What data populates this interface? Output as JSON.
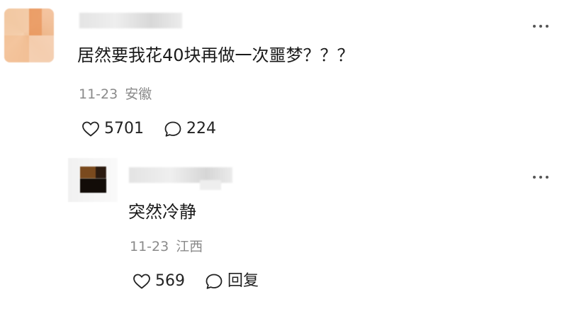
{
  "comment": {
    "text": "居然要我花40块再做一次噩梦？？？",
    "date": "11-23",
    "location": "安徽",
    "likes": "5701",
    "replies": "224"
  },
  "reply": {
    "text": "突然冷静",
    "date": "11-23",
    "location": "江西",
    "likes": "569",
    "reply_label": "回复"
  },
  "icons": {
    "more": "more-dots-icon",
    "like": "heart-icon",
    "comment": "comment-bubble-icon"
  },
  "colors": {
    "text": "#1a1a1a",
    "meta": "#8a8a8a",
    "icon": "#222222"
  }
}
